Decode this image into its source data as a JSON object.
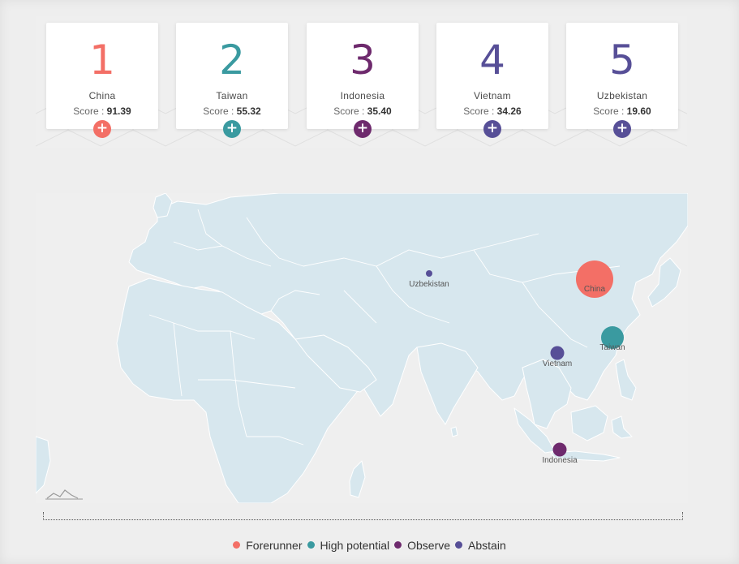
{
  "colors": {
    "forerunner": "#f36f66",
    "high_potential": "#3a9aa0",
    "observe": "#6e2a6d",
    "abstain": "#574f97",
    "land": "#d7e7ee",
    "border": "#ffffff"
  },
  "cards": [
    {
      "rank": "1",
      "country": "China",
      "score_label": "Score :",
      "score": "91.39",
      "category": "forerunner",
      "icon": "plus-icon"
    },
    {
      "rank": "2",
      "country": "Taiwan",
      "score_label": "Score :",
      "score": "55.32",
      "category": "high_potential",
      "icon": "plus-icon"
    },
    {
      "rank": "3",
      "country": "Indonesia",
      "score_label": "Score :",
      "score": "35.40",
      "category": "observe",
      "icon": "plus-icon"
    },
    {
      "rank": "4",
      "country": "Vietnam",
      "score_label": "Score :",
      "score": "34.26",
      "category": "abstain",
      "icon": "plus-icon"
    },
    {
      "rank": "5",
      "country": "Uzbekistan",
      "score_label": "Score :",
      "score": "19.60",
      "category": "abstain",
      "icon": "plus-icon"
    }
  ],
  "map": {
    "markers": [
      {
        "label": "China",
        "category": "forerunner",
        "score": 91.39
      },
      {
        "label": "Taiwan",
        "category": "high_potential",
        "score": 55.32
      },
      {
        "label": "Vietnam",
        "category": "abstain",
        "score": 34.26
      },
      {
        "label": "Indonesia",
        "category": "observe",
        "score": 35.4
      },
      {
        "label": "Uzbekistan",
        "category": "abstain",
        "score": 19.6
      }
    ]
  },
  "legend": [
    {
      "label": "Forerunner",
      "category": "forerunner"
    },
    {
      "label": "High potential",
      "category": "high_potential"
    },
    {
      "label": "Observe",
      "category": "observe"
    },
    {
      "label": "Abstain",
      "category": "abstain"
    }
  ]
}
